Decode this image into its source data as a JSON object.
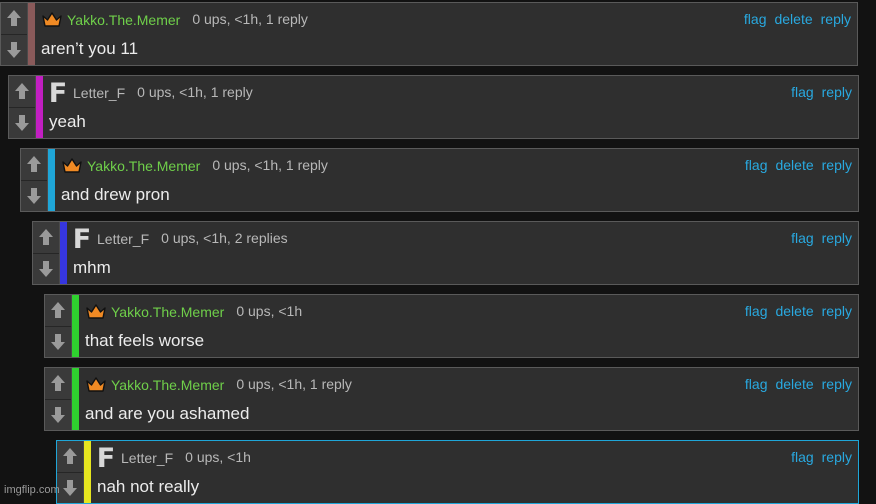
{
  "colors": {
    "username_memer": "#6fcf4a",
    "username_letterf": "#b8b8b8",
    "action_link": "#29a9e0",
    "crown_icon": "#f08a24"
  },
  "comments": [
    {
      "user": "Yakko.The.Memer",
      "badge": "crown-icon",
      "meta": "0 ups, <1h, 1 reply",
      "text": "aren’t you 11",
      "actions": [
        "flag",
        "delete",
        "reply"
      ],
      "depth_color": "#8a5a5a"
    },
    {
      "user": "Letter_F",
      "badge": "F",
      "meta": "0 ups, <1h, 1 reply",
      "text": "yeah",
      "actions": [
        "flag",
        "reply"
      ],
      "depth_color": "#c21fc2"
    },
    {
      "user": "Yakko.The.Memer",
      "badge": "crown-icon",
      "meta": "0 ups, <1h, 1 reply",
      "text": "and drew pron",
      "actions": [
        "flag",
        "delete",
        "reply"
      ],
      "depth_color": "#1fa6d8"
    },
    {
      "user": "Letter_F",
      "badge": "F",
      "meta": "0 ups, <1h, 2 replies",
      "text": "mhm",
      "actions": [
        "flag",
        "reply"
      ],
      "depth_color": "#3636e0"
    },
    {
      "user": "Yakko.The.Memer",
      "badge": "crown-icon",
      "meta": "0 ups, <1h",
      "text": "that feels worse",
      "actions": [
        "flag",
        "delete",
        "reply"
      ],
      "depth_color": "#2fd12f"
    },
    {
      "user": "Yakko.The.Memer",
      "badge": "crown-icon",
      "meta": "0 ups, <1h, 1 reply",
      "text": "and are you ashamed",
      "actions": [
        "flag",
        "delete",
        "reply"
      ],
      "depth_color": "#2fd12f"
    },
    {
      "user": "Letter_F",
      "badge": "F",
      "meta": "0 ups, <1h",
      "text": "nah not really",
      "actions": [
        "flag",
        "reply"
      ],
      "depth_color": "#e6e61f"
    }
  ],
  "watermark": "imgflip.com"
}
